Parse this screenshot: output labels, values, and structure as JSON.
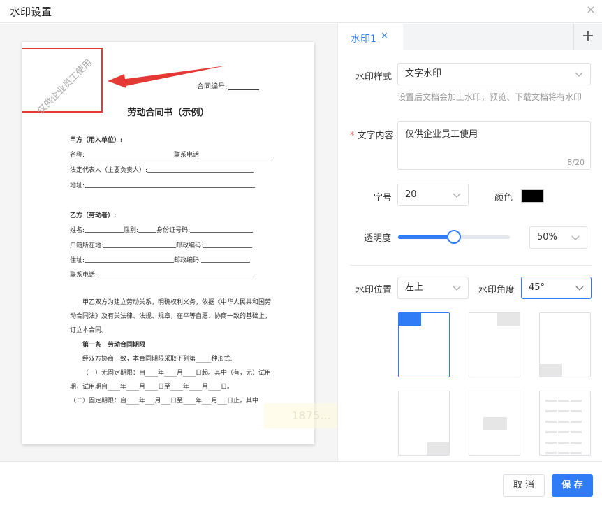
{
  "dialog": {
    "title": "水印设置",
    "close_label": "×"
  },
  "preview": {
    "watermark_text": "仅供企业员工使用",
    "contract_no_label": "合同编号:",
    "doc_title": "劳动合同书（示例）",
    "party_a": {
      "heading": "甲方（用人单位）:",
      "name_label": "名称:",
      "phone_label": "联系电话:",
      "rep_label": "法定代表人（主要负责人）:",
      "address_label": "地址:"
    },
    "party_b": {
      "heading": "乙方（劳动者）:",
      "name_label": "姓名:",
      "gender_label": "性别:",
      "id_label": "身份证号码:",
      "hukou_label": "户籍所在地:",
      "zip_label": "邮政编码:",
      "residence_label": "住址:",
      "zip_label_2": "邮政编码:",
      "phone_label": "联系电话:"
    },
    "intro": "甲乙双方为建立劳动关系，明确权利义务，依据《中华人民共和国劳动合同法》及有关法律、法规、规章，在平等自愿、协商一致的基础上，订立本合同。",
    "article1_title": "第一条　劳动合同期限",
    "article1_intro": "经双方协商一致，本合同期限采取下列第_____种形式:",
    "article1_item1": "（一）无固定期限：自____年____月____日起。其中（有，无）试用期，试用期自____年____月____日至____年____月____日。",
    "article1_item2": "（二）固定期限：自____年___月___日至____年___月___日止。其中",
    "faint_overlay": "1875..."
  },
  "tabs": [
    {
      "label": "水印1",
      "close": "×"
    }
  ],
  "tab_add_label": "+",
  "form": {
    "style_label": "水印样式",
    "style_value": "文字水印",
    "style_hint": "设置后文档会加上水印，预览、下载文档将有水印",
    "content_required_mark": "*",
    "content_label": "文字内容",
    "content_value": "仅供企业员工使用",
    "content_count": "8/20",
    "size_label": "字号",
    "size_value": "20",
    "color_label": "颜色",
    "color_value": "#000000",
    "opacity_label": "透明度",
    "opacity_percent": 50,
    "opacity_value": "50%",
    "position_label": "水印位置",
    "position_value": "左上",
    "angle_label": "水印角度",
    "angle_value": "45°"
  },
  "positions": [
    {
      "id": "top-left",
      "selected": true
    },
    {
      "id": "top-right",
      "selected": false
    },
    {
      "id": "bottom-left",
      "selected": false
    },
    {
      "id": "bottom-right",
      "selected": false
    },
    {
      "id": "center",
      "selected": false
    },
    {
      "id": "tiled",
      "selected": false
    }
  ],
  "footer": {
    "cancel_label": "取 消",
    "save_label": "保 存"
  },
  "colors": {
    "accent": "#2f7cf6",
    "highlight_red": "#e53935"
  }
}
